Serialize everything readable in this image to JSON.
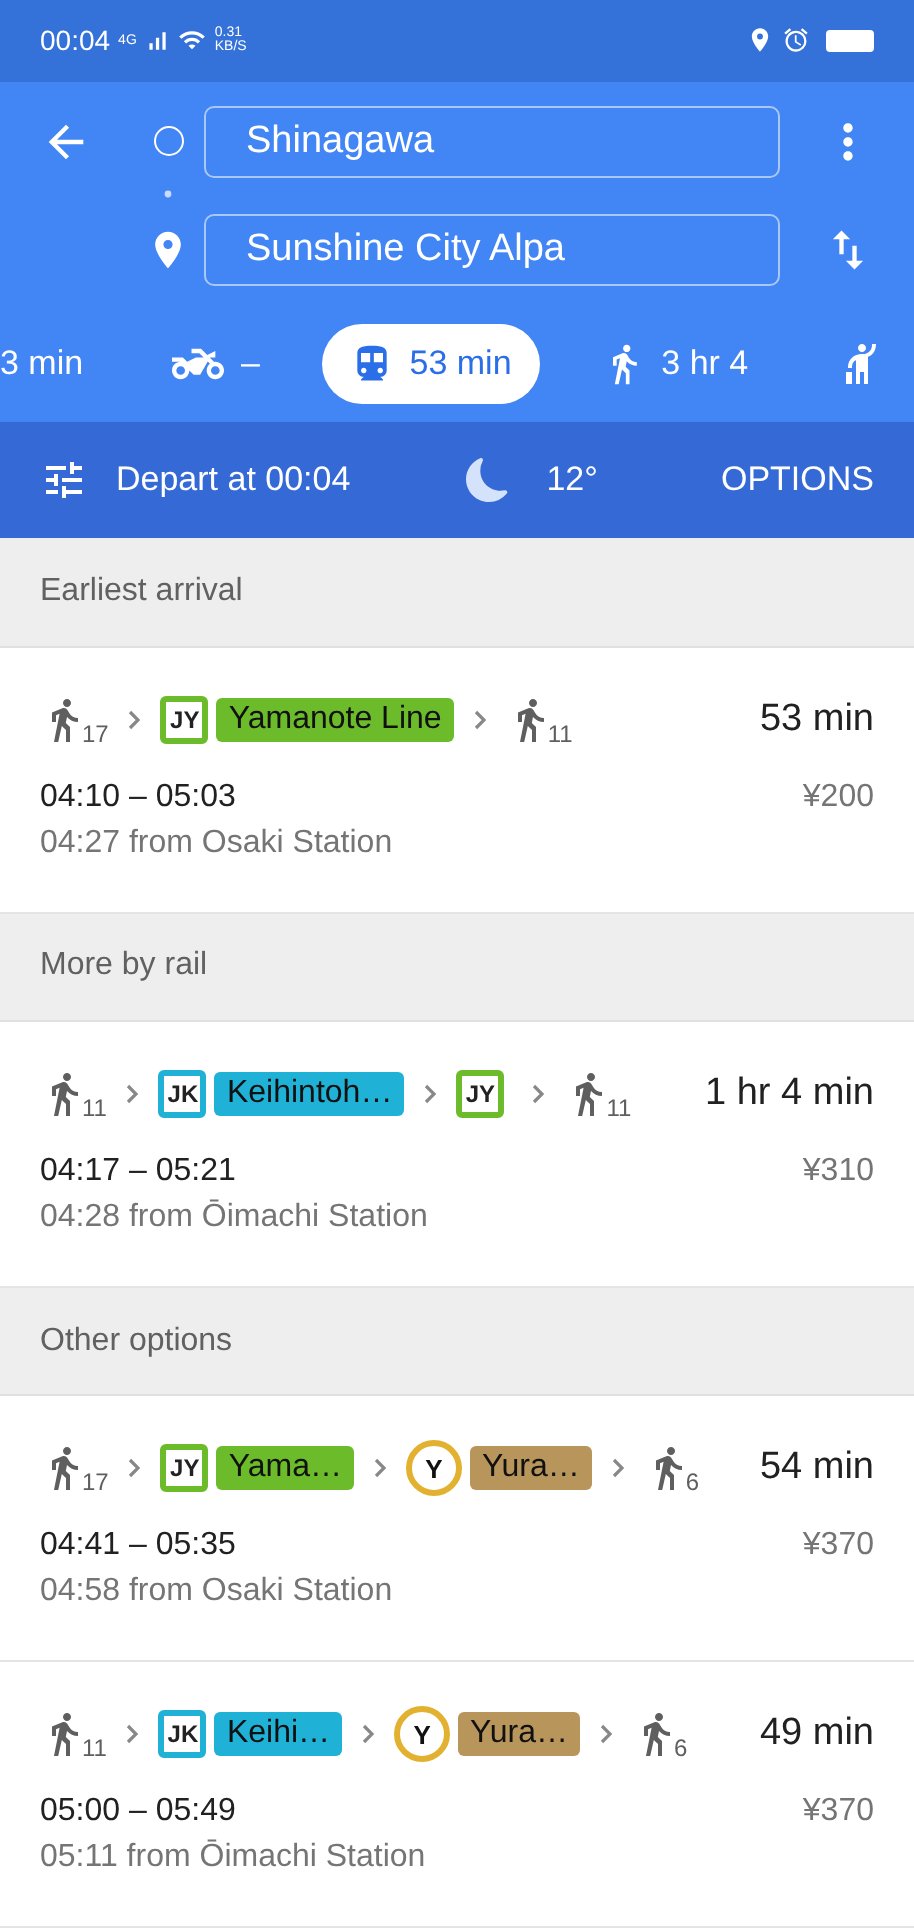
{
  "status_bar": {
    "time": "00:04",
    "network": "4G",
    "speed": "0.31",
    "speed_unit": "KB/S"
  },
  "search": {
    "origin": "Shinagawa",
    "destination": "Sunshine City Alpa"
  },
  "modes": [
    {
      "label": "3 min",
      "selected": false
    },
    {
      "kind": "motorcycle",
      "label": "–",
      "selected": false
    },
    {
      "kind": "transit",
      "label": "53 min",
      "selected": true
    },
    {
      "kind": "walk",
      "label": "3 hr 4",
      "selected": false
    },
    {
      "kind": "ride",
      "selected": false
    }
  ],
  "depart_bar": {
    "depart": "Depart at 00:04",
    "temperature": "12°",
    "options": "OPTIONS"
  },
  "sections": [
    {
      "title": "Earliest arrival",
      "routes": [
        {
          "steps": [
            {
              "kind": "walk",
              "minutes": "17"
            },
            {
              "kind": "line",
              "code": "JY",
              "name": "Yamanote Line",
              "color": "#6cbb2a"
            },
            {
              "kind": "walk",
              "minutes": "11"
            }
          ],
          "duration": "53 min",
          "times": "04:10 – 05:03",
          "fare": "¥200",
          "departure": "04:27 from Osaki Station"
        }
      ]
    },
    {
      "title": "More by rail",
      "routes": [
        {
          "steps": [
            {
              "kind": "walk",
              "minutes": "11"
            },
            {
              "kind": "line",
              "code": "JK",
              "name": "Keihintoh…",
              "color": "#1fb1d6"
            },
            {
              "kind": "line",
              "code": "JY",
              "color": "#6cbb2a"
            },
            {
              "kind": "walk",
              "minutes": "11"
            }
          ],
          "duration": "1 hr 4 min",
          "times": "04:17 – 05:21",
          "fare": "¥310",
          "departure": "04:28 from Ōimachi Station"
        }
      ]
    },
    {
      "title": "Other options",
      "routes": [
        {
          "steps": [
            {
              "kind": "walk",
              "minutes": "17"
            },
            {
              "kind": "line",
              "code": "JY",
              "name": "Yama…",
              "color": "#6cbb2a"
            },
            {
              "kind": "subway",
              "code": "Y",
              "name": "Yura…",
              "color": "#b8955b"
            },
            {
              "kind": "walk",
              "minutes": "6"
            }
          ],
          "duration": "54 min",
          "times": "04:41 – 05:35",
          "fare": "¥370",
          "departure": "04:58 from Osaki Station"
        },
        {
          "steps": [
            {
              "kind": "walk",
              "minutes": "11"
            },
            {
              "kind": "line",
              "code": "JK",
              "name": "Keihi…",
              "color": "#1fb1d6"
            },
            {
              "kind": "subway",
              "code": "Y",
              "name": "Yura…",
              "color": "#b8955b"
            },
            {
              "kind": "walk",
              "minutes": "6"
            }
          ],
          "duration": "49 min",
          "times": "05:00 – 05:49",
          "fare": "¥370",
          "departure": "05:11 from Ōimachi Station"
        }
      ]
    }
  ]
}
